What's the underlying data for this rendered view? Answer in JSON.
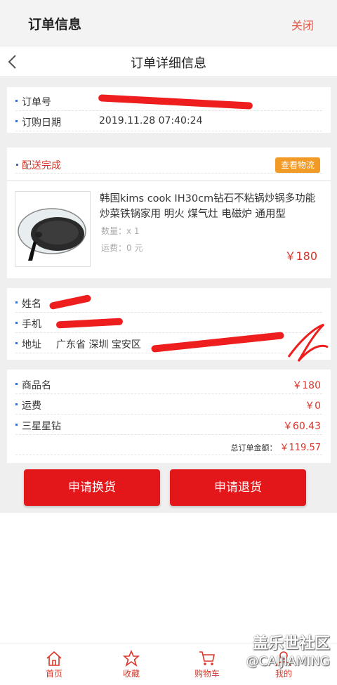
{
  "header": {
    "title": "订单信息",
    "close_label": "关闭"
  },
  "subheader": {
    "title": "订单详细信息"
  },
  "order": {
    "number_label": "订单号",
    "date_label": "订购日期",
    "date_value": "2019.11.28 07:40:24"
  },
  "delivery": {
    "status": "配送完成",
    "logistics_button": "查看物流"
  },
  "product": {
    "name": "韩国kims cook IH30cm钻石不粘锅炒锅多功能炒菜铁锅家用 明火 煤气灶 电磁炉 通用型",
    "quantity": "数量：x 1",
    "shipping": "运费：0 元",
    "price": "￥180"
  },
  "recipient": {
    "name_label": "姓名",
    "phone_label": "手机",
    "address_label": "地址",
    "address_value": "广东省 深圳 宝安区"
  },
  "summary": {
    "items": [
      {
        "label": "商品名",
        "value": "￥180"
      },
      {
        "label": "运费",
        "value": "￥0"
      },
      {
        "label": "三星星钻",
        "value": "￥60.43"
      }
    ],
    "total_label": "总订单金额：",
    "total_value": "￥119.57"
  },
  "actions": {
    "exchange": "申请换货",
    "refund": "申请退货"
  },
  "tabs": [
    {
      "label": "首页",
      "icon": "home-icon"
    },
    {
      "label": "收藏",
      "icon": "star-icon"
    },
    {
      "label": "购物车",
      "icon": "cart-icon"
    },
    {
      "label": "我的",
      "icon": "user-icon"
    }
  ],
  "watermark": {
    "line1": "盖乐世社区",
    "line2": "@CAIJIAMING"
  },
  "colors": {
    "accent": "#e3161a",
    "orange": "#f19a26",
    "link": "#e25a4a"
  }
}
